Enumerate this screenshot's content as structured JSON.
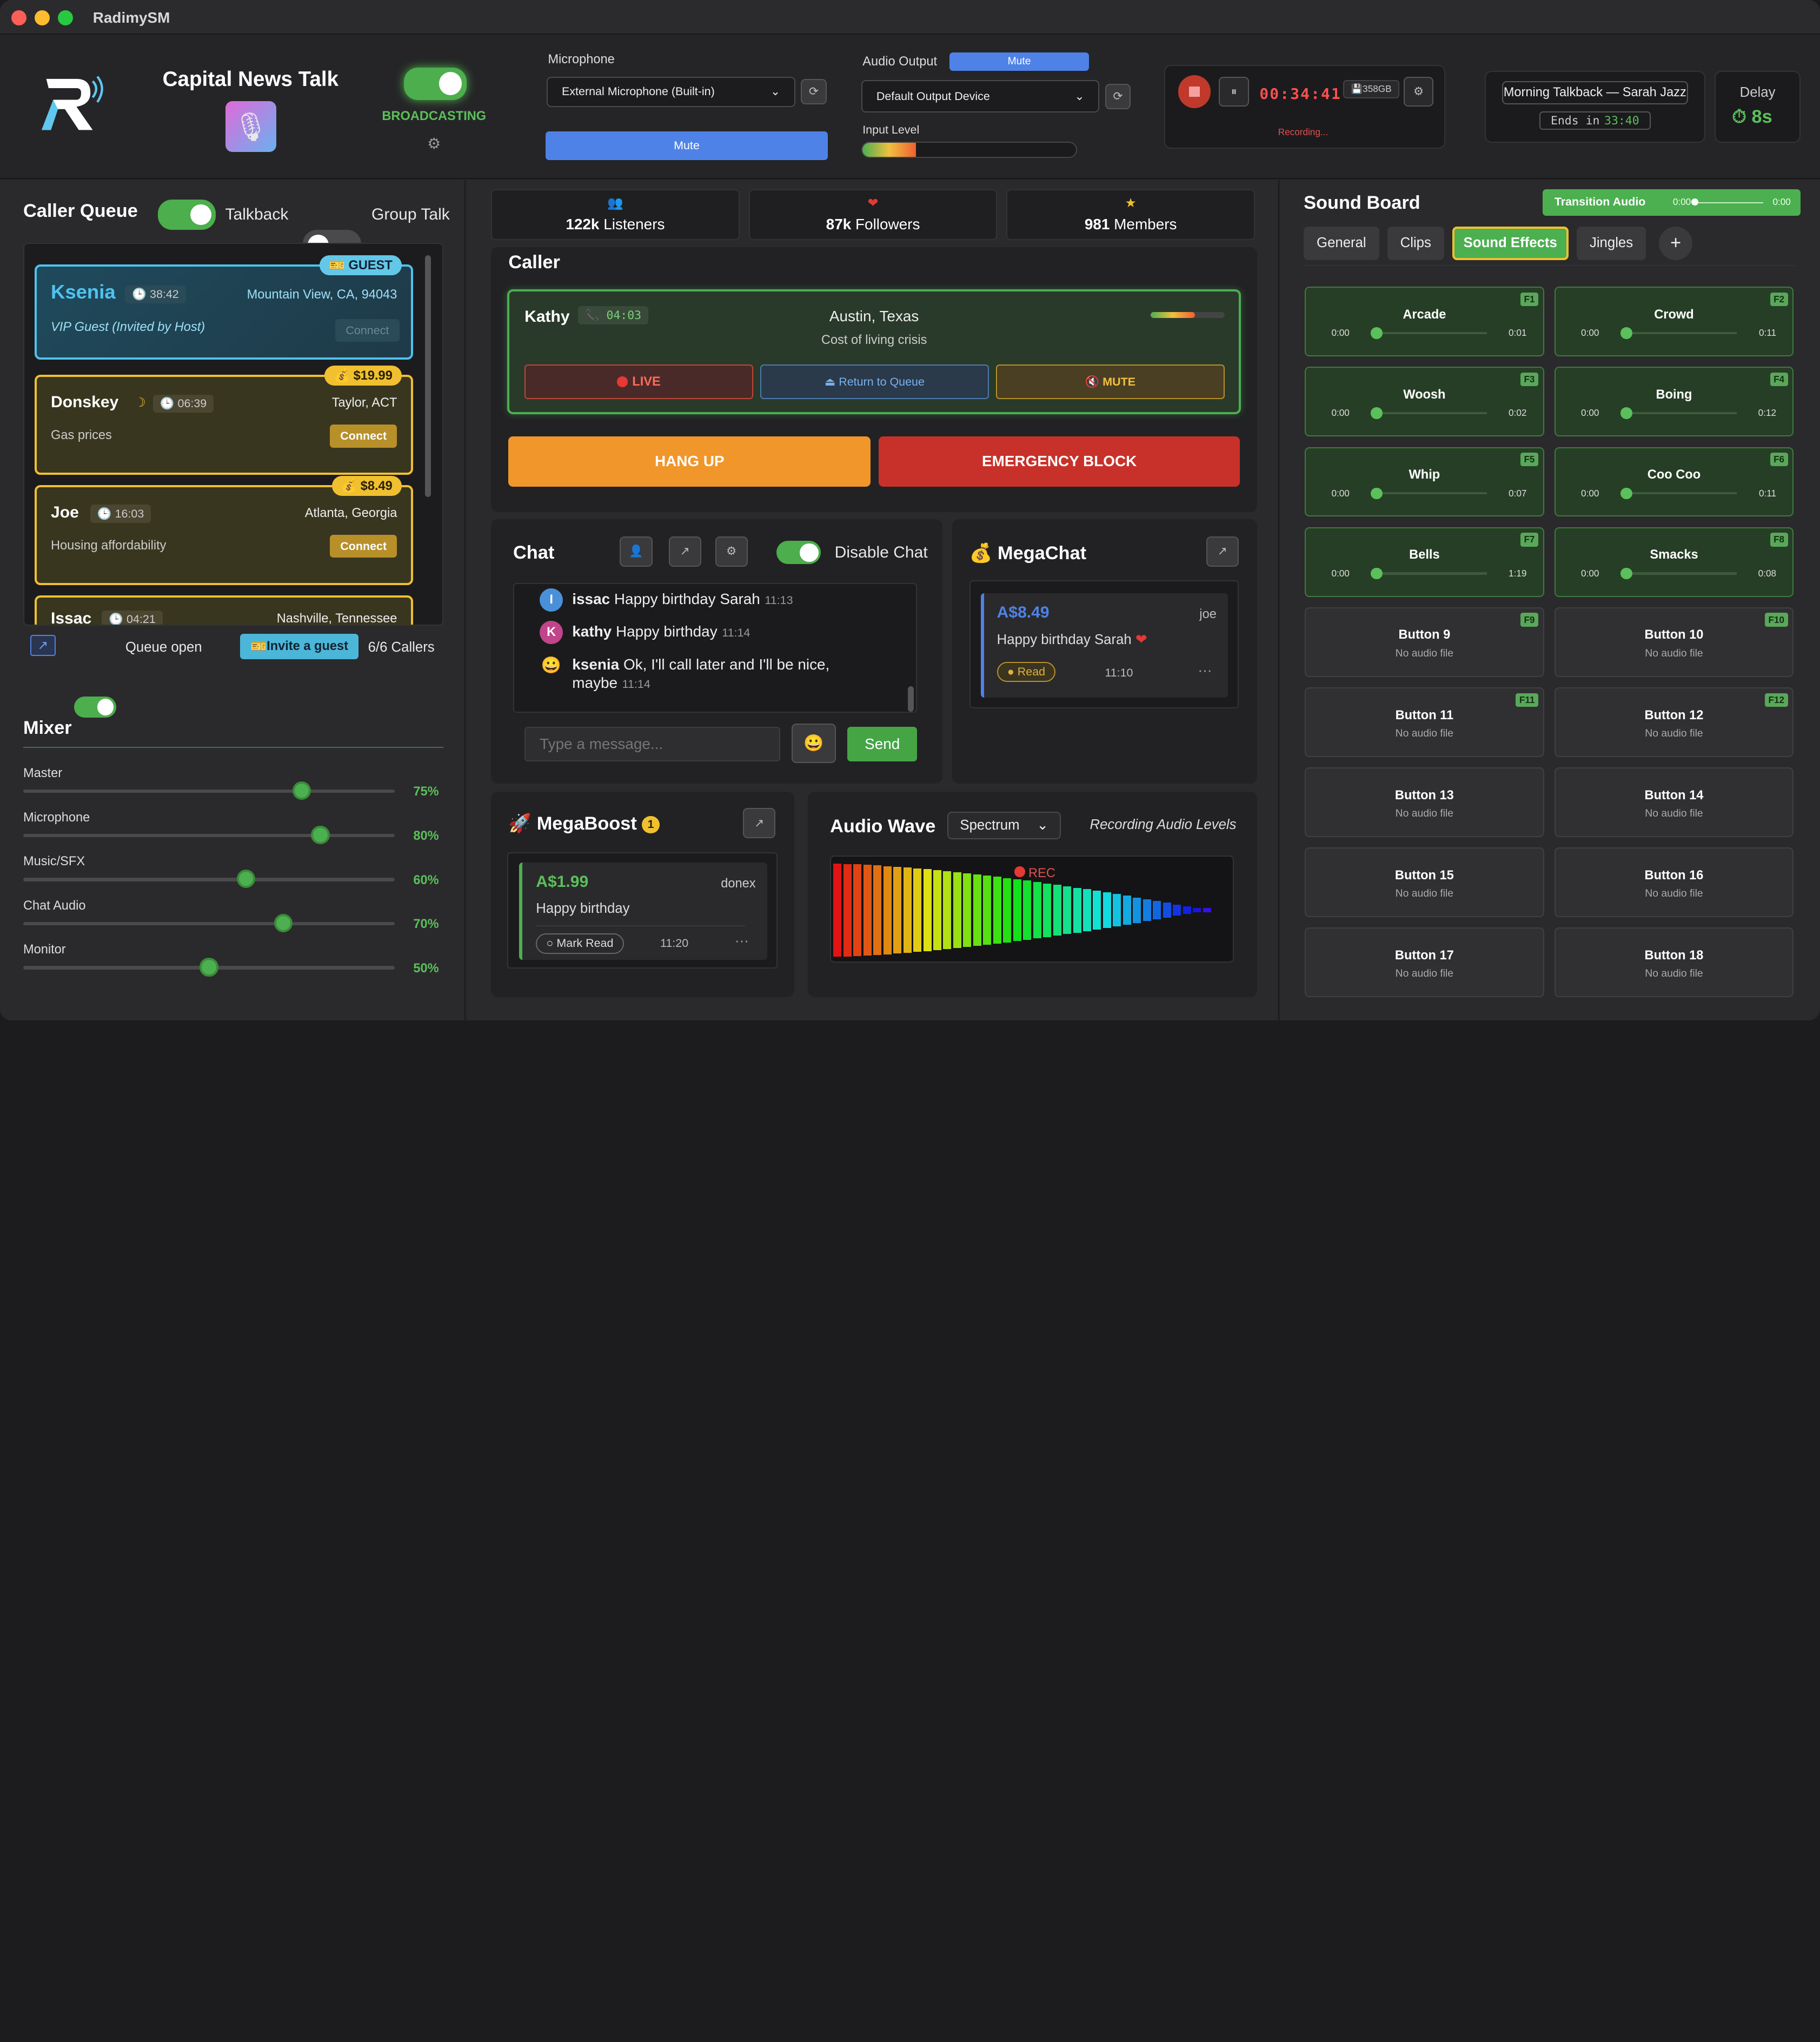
{
  "app": {
    "title": "RadimySM"
  },
  "station": {
    "name": "Capital News Talk",
    "status": "BROADCASTING"
  },
  "microphone": {
    "label": "Microphone",
    "device": "External Microphone (Built-in)",
    "mute": "Mute"
  },
  "audio_output": {
    "label": "Audio Output",
    "mute": "Mute",
    "device": "Default Output Device",
    "input_level_label": "Input Level",
    "input_level": 0.25
  },
  "recorder": {
    "time": "00:34:41",
    "storage": "358GB",
    "status": "Recording..."
  },
  "show": {
    "title": "Morning Talkback — Sarah Jazz",
    "ends_label": "Ends in",
    "ends_time": "33:40"
  },
  "delay": {
    "label": "Delay",
    "value": "8s"
  },
  "queue": {
    "title": "Caller Queue",
    "talkback_label": "Talkback",
    "group_label": "Group Talk",
    "callers": [
      {
        "name": "Ksenia",
        "time": "38:42",
        "location": "Mountain View, CA, 94043",
        "topic": "VIP Guest (Invited by Host)",
        "badge": "GUEST",
        "action": "Connect"
      },
      {
        "name": "Donskey",
        "time": "06:39",
        "location": "Taylor, ACT",
        "topic": "Gas prices",
        "badge": "$19.99",
        "action": "Connect"
      },
      {
        "name": "Joe",
        "time": "16:03",
        "location": "Atlanta, Georgia",
        "topic": "Housing affordability",
        "badge": "$8.49",
        "action": "Connect"
      },
      {
        "name": "Issac",
        "time": "04:21",
        "location": "Nashville, Tennessee"
      }
    ],
    "queue_open_label": "Queue open",
    "invite_label": "Invite a guest",
    "callers_count": "6/6 Callers"
  },
  "mixer": {
    "title": "Mixer",
    "channels": [
      {
        "label": "Master",
        "value": "75%",
        "level": 0.75
      },
      {
        "label": "Microphone",
        "value": "80%",
        "level": 0.8
      },
      {
        "label": "Music/SFX",
        "value": "60%",
        "level": 0.6
      },
      {
        "label": "Chat Audio",
        "value": "70%",
        "level": 0.7
      },
      {
        "label": "Monitor",
        "value": "50%",
        "level": 0.5
      }
    ]
  },
  "stats": [
    {
      "value": "122k",
      "label": "Listeners",
      "icon": "people-icon"
    },
    {
      "value": "87k",
      "label": "Followers",
      "icon": "heart-icon"
    },
    {
      "value": "981",
      "label": "Members",
      "icon": "star-icon"
    }
  ],
  "caller": {
    "title": "Caller",
    "name": "Kathy",
    "time": "04:03",
    "location": "Austin, Texas",
    "topic": "Cost of living crisis",
    "live": "LIVE",
    "return": "Return to Queue",
    "mute": "MUTE",
    "hangup": "HANG UP",
    "block": "EMERGENCY BLOCK"
  },
  "chat": {
    "title": "Chat",
    "disable_label": "Disable Chat",
    "messages": [
      {
        "initial": "I",
        "user": "issac",
        "text": "Happy birthday Sarah",
        "time": "11:13",
        "color": "#4a90d9"
      },
      {
        "initial": "K",
        "user": "kathy",
        "text": "Happy birthday",
        "time": "11:14",
        "color": "#c0458a"
      },
      {
        "initial": "😀",
        "user": "ksenia",
        "text": "Ok, I'll call later and I'll be nice,",
        "text2": "maybe",
        "time": "11:14",
        "color": "#d9a93a"
      }
    ],
    "placeholder": "Type a message...",
    "send": "Send"
  },
  "megachat": {
    "title": "MegaChat",
    "amount": "A$8.49",
    "user": "joe",
    "message": "Happy birthday Sarah",
    "status": "Read",
    "time": "11:10"
  },
  "megaboost": {
    "title": "MegaBoost",
    "count": "1",
    "amount": "A$1.99",
    "user": "donex",
    "message": "Happy birthday",
    "action": "Mark Read",
    "time": "11:20"
  },
  "wave": {
    "title": "Audio Wave",
    "mode": "Spectrum",
    "subtitle": "Recording Audio Levels",
    "rec": "REC"
  },
  "soundboard": {
    "title": "Sound Board",
    "transition_label": "Transition Audio",
    "transition_start": "0:00",
    "transition_end": "0:00",
    "tabs": [
      "General",
      "Clips",
      "Sound Effects",
      "Jingles"
    ],
    "add": "+",
    "buttons": [
      {
        "name": "Arcade",
        "key": "F1",
        "start": "0:00",
        "end": "0:01"
      },
      {
        "name": "Crowd",
        "key": "F2",
        "start": "0:00",
        "end": "0:11"
      },
      {
        "name": "Woosh",
        "key": "F3",
        "start": "0:00",
        "end": "0:02"
      },
      {
        "name": "Boing",
        "key": "F4",
        "start": "0:00",
        "end": "0:12"
      },
      {
        "name": "Whip",
        "key": "F5",
        "start": "0:00",
        "end": "0:07"
      },
      {
        "name": "Coo Coo",
        "key": "F6",
        "start": "0:00",
        "end": "0:11"
      },
      {
        "name": "Bells",
        "key": "F7",
        "start": "0:00",
        "end": "1:19"
      },
      {
        "name": "Smacks",
        "key": "F8",
        "start": "0:00",
        "end": "0:08"
      },
      {
        "name": "Button 9",
        "key": "F9",
        "sub": "No audio file"
      },
      {
        "name": "Button 10",
        "key": "F10",
        "sub": "No audio file"
      },
      {
        "name": "Button 11",
        "key": "F11",
        "sub": "No audio file"
      },
      {
        "name": "Button 12",
        "key": "F12",
        "sub": "No audio file"
      },
      {
        "name": "Button 13",
        "sub": "No audio file"
      },
      {
        "name": "Button 14",
        "sub": "No audio file"
      },
      {
        "name": "Button 15",
        "sub": "No audio file"
      },
      {
        "name": "Button 16",
        "sub": "No audio file"
      },
      {
        "name": "Button 17",
        "sub": "No audio file"
      },
      {
        "name": "Button 18",
        "sub": "No audio file"
      }
    ]
  }
}
